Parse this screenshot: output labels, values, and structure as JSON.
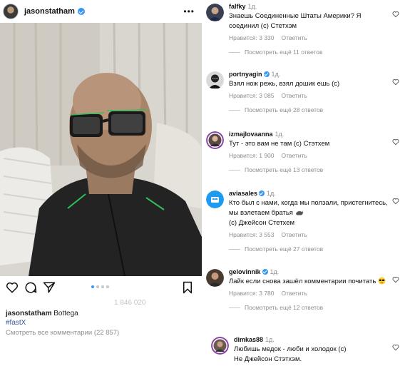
{
  "post": {
    "username": "jasonstatham",
    "likes_ghost": "1 846 020",
    "caption_user": "jasonstatham",
    "caption_text": "Bottega",
    "hashtag": "#fastX",
    "view_all": "Смотреть все комментарии (22 857)",
    "carousel": {
      "count": 4,
      "active": 0
    }
  },
  "icons": {
    "like": "heart-icon",
    "comment": "comment-icon",
    "share": "send-icon",
    "save": "bookmark-icon",
    "more": "more-options-icon"
  },
  "colors": {
    "verified": "#3897f0",
    "hashtag": "#385898",
    "muted": "#8e8e8e"
  },
  "comments": [
    {
      "user": "falfky",
      "verified": false,
      "time": "1д.",
      "text": "Знаешь Соединенные Штаты Америки? Я соединил (с) Стетхэм",
      "likes": "Нравится: 3 330",
      "reply": "Ответить",
      "replies": "Посмотреть ещё 11 ответов"
    },
    {
      "user": "portnyagin",
      "verified": true,
      "time": "1д.",
      "text": "Взял нож режь, взял дошик ешь (с)",
      "likes": "Нравится: 3 085",
      "reply": "Ответить",
      "replies": "Посмотреть ещё 28 ответов"
    },
    {
      "user": "izmajlovaanna",
      "verified": false,
      "time": "1д.",
      "text": "Тут - это вам не там (с) Стэтхем",
      "likes": "Нравится: 1 900",
      "reply": "Ответить",
      "replies": "Посмотреть ещё 13 ответов"
    },
    {
      "user": "aviasales",
      "verified": true,
      "time": "1д.",
      "text": "Кто был с нами, когда мы ползали, пристегнитесь, мы взлетаем братья",
      "text_end": "(с) Джейсон Стетхем",
      "likes": "Нравится: 3 553",
      "reply": "Ответить",
      "replies": "Посмотреть ещё 27 ответов"
    },
    {
      "user": "gelovinnik",
      "verified": true,
      "time": "1д.",
      "text": "Лайк если снова зашёл комментарии почитать",
      "likes": "Нравится: 3 780",
      "reply": "Ответить",
      "replies": "Посмотреть ещё 12 ответов"
    },
    {
      "user": "dimkas88",
      "verified": false,
      "time": "1д.",
      "text": "Любишь медок - люби и холодок (с)",
      "text_end": "Не Джейсон Стэтхэм."
    }
  ]
}
